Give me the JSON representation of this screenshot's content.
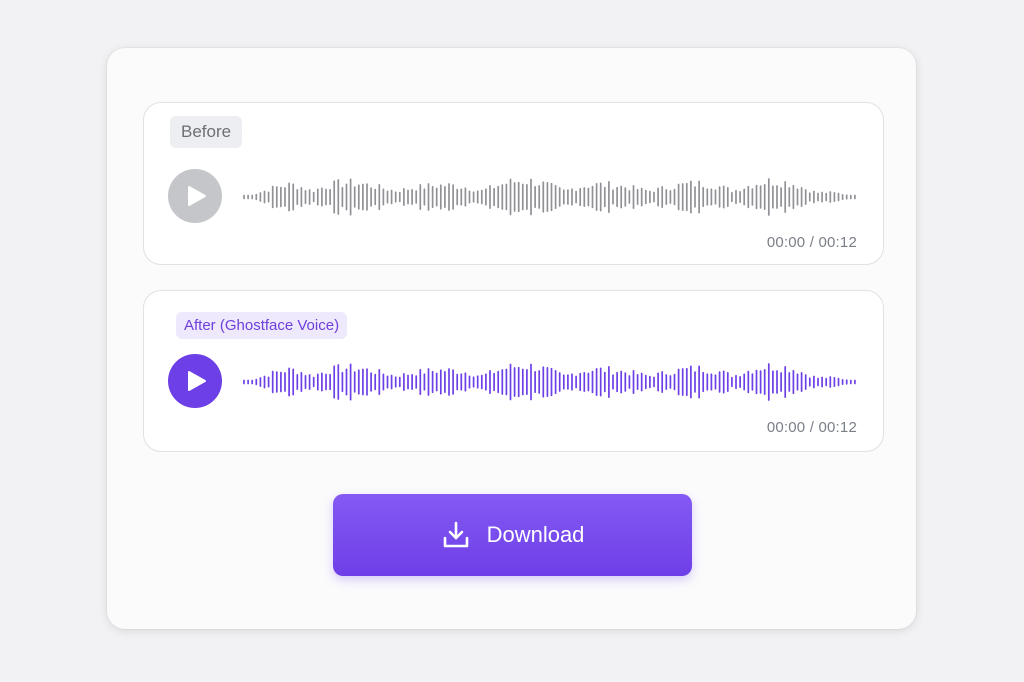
{
  "before": {
    "badge": "Before",
    "time": "00:00 / 00:12",
    "wave_color": "#8f9196",
    "play_color": "#c4c6ca"
  },
  "after": {
    "badge": "After (Ghostface Voice)",
    "time": "00:00 / 00:12",
    "wave_color": "#6d3fe6",
    "play_color": "#6d3fe6"
  },
  "download": {
    "label": "Download",
    "icon": "download-icon"
  },
  "colors": {
    "accent": "#6d3fe6",
    "badge_after_bg": "#efe9fd",
    "badge_before_bg": "#eceef1"
  }
}
